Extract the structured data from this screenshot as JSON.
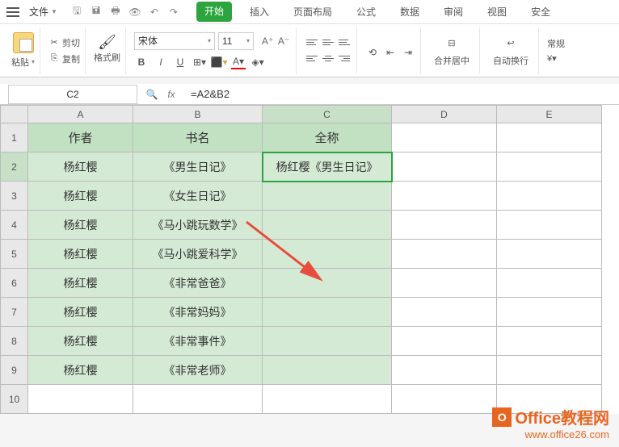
{
  "menu": {
    "file": "文件",
    "tabs": [
      "开始",
      "插入",
      "页面布局",
      "公式",
      "数据",
      "审阅",
      "视图",
      "安全"
    ],
    "active_tab": "开始"
  },
  "ribbon": {
    "paste": "粘贴",
    "cut": "剪切",
    "copy": "复制",
    "format_painter": "格式刷",
    "font_name": "宋体",
    "font_size": "11",
    "merge_center": "合并居中",
    "auto_wrap": "自动换行",
    "general": "常规"
  },
  "formula_bar": {
    "name_box": "C2",
    "fx_label": "fx",
    "formula": "=A2&B2"
  },
  "sheet": {
    "cols": [
      "A",
      "B",
      "C",
      "D",
      "E"
    ],
    "headers": {
      "A": "作者",
      "B": "书名",
      "C": "全称"
    },
    "rows": [
      {
        "n": 1,
        "A": "作者",
        "B": "书名",
        "C": "全称",
        "header": true
      },
      {
        "n": 2,
        "A": "杨红樱",
        "B": "《男生日记》",
        "C": "杨红樱《男生日记》"
      },
      {
        "n": 3,
        "A": "杨红樱",
        "B": "《女生日记》",
        "C": ""
      },
      {
        "n": 4,
        "A": "杨红樱",
        "B": "《马小跳玩数学》",
        "C": ""
      },
      {
        "n": 5,
        "A": "杨红樱",
        "B": "《马小跳爱科学》",
        "C": ""
      },
      {
        "n": 6,
        "A": "杨红樱",
        "B": "《非常爸爸》",
        "C": ""
      },
      {
        "n": 7,
        "A": "杨红樱",
        "B": "《非常妈妈》",
        "C": ""
      },
      {
        "n": 8,
        "A": "杨红樱",
        "B": "《非常事件》",
        "C": ""
      },
      {
        "n": 9,
        "A": "杨红樱",
        "B": "《非常老师》",
        "C": ""
      }
    ],
    "selected_cell": "C2"
  },
  "watermark": {
    "brand": "Office教程网",
    "url": "www.office26.com"
  }
}
